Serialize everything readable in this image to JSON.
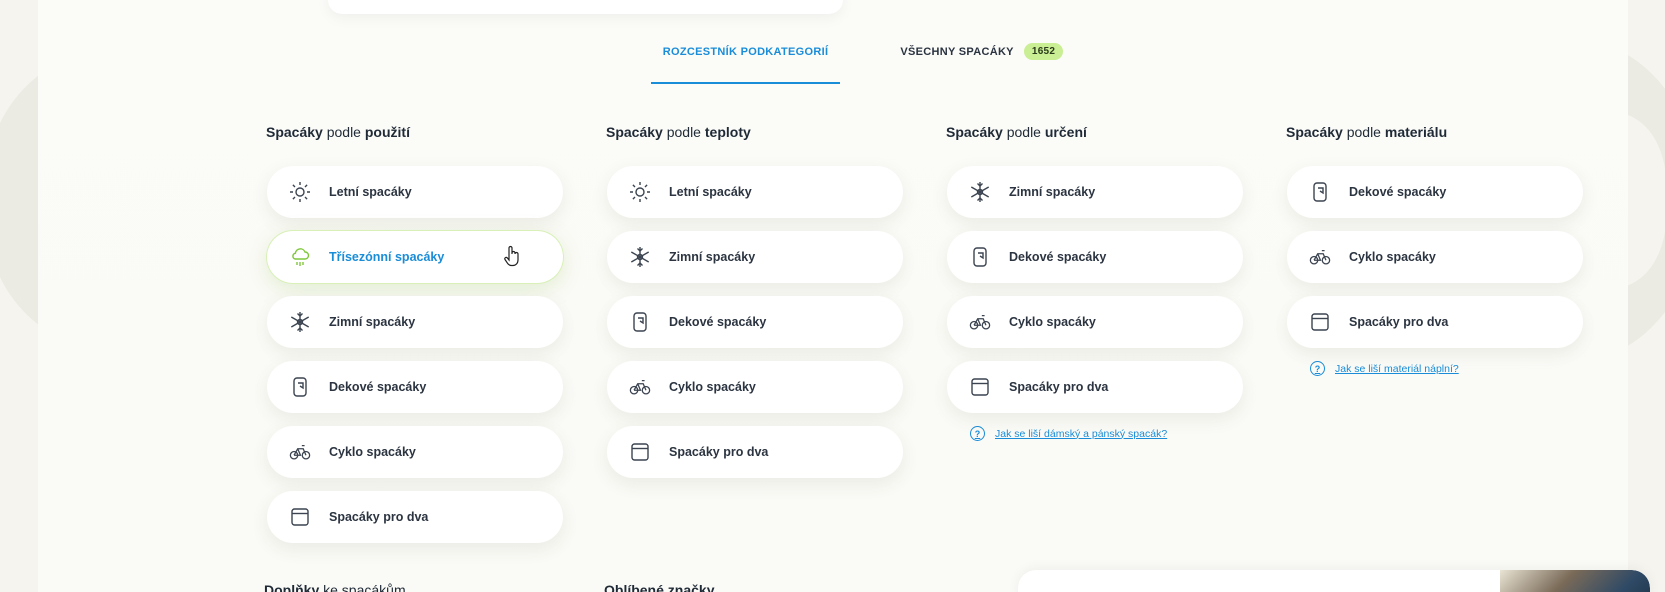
{
  "tabs": [
    {
      "label": "ROZCESTNÍK PODKATEGORIÍ",
      "active": true
    },
    {
      "label": "VŠECHNY SPACÁKY",
      "badge": "1652",
      "active": false
    }
  ],
  "columns": [
    {
      "heading_bold": "Spacáky",
      "heading_mid": " podle ",
      "heading_key": "použití",
      "items": [
        {
          "label": "Letní spacáky",
          "icon": "sun-icon"
        },
        {
          "label": "Třísezónní spacáky",
          "icon": "cloud-rain-icon",
          "hover": true
        },
        {
          "label": "Zimní spacáky",
          "icon": "snowflake-icon"
        },
        {
          "label": "Dekové spacáky",
          "icon": "blanket-bag-icon"
        },
        {
          "label": "Cyklo spacáky",
          "icon": "bicycle-icon"
        },
        {
          "label": "Spacáky pro dva",
          "icon": "double-bag-icon"
        }
      ]
    },
    {
      "heading_bold": "Spacáky",
      "heading_mid": " podle ",
      "heading_key": "teploty",
      "items": [
        {
          "label": "Letní spacáky",
          "icon": "sun-icon"
        },
        {
          "label": "Zimní spacáky",
          "icon": "snowflake-icon"
        },
        {
          "label": "Dekové spacáky",
          "icon": "blanket-bag-icon"
        },
        {
          "label": "Cyklo spacáky",
          "icon": "bicycle-icon"
        },
        {
          "label": "Spacáky pro dva",
          "icon": "double-bag-icon"
        }
      ]
    },
    {
      "heading_bold": "Spacáky",
      "heading_mid": " podle ",
      "heading_key": "určení",
      "items": [
        {
          "label": "Zimní spacáky",
          "icon": "snowflake-icon"
        },
        {
          "label": "Dekové spacáky",
          "icon": "blanket-bag-icon"
        },
        {
          "label": "Cyklo spacáky",
          "icon": "bicycle-icon"
        },
        {
          "label": "Spacáky pro dva",
          "icon": "double-bag-icon"
        }
      ],
      "help": "Jak se liší dámský a pánský spacák?"
    },
    {
      "heading_bold": "Spacáky",
      "heading_mid": " podle ",
      "heading_key": "materiálu",
      "items": [
        {
          "label": "Dekové spacáky",
          "icon": "blanket-bag-icon"
        },
        {
          "label": "Cyklo spacáky",
          "icon": "bicycle-icon"
        },
        {
          "label": "Spacáky pro dva",
          "icon": "double-bag-icon"
        }
      ],
      "help": "Jak se liší materiál náplní?"
    }
  ],
  "bottom": {
    "left_bold": "Doplňky",
    "left_rest": " ke spacákům",
    "right_bold": "Oblíbené značky"
  },
  "colors": {
    "accent": "#1a8dd8",
    "badge": "#c9ee93",
    "hover_icon": "#7fc73b"
  }
}
